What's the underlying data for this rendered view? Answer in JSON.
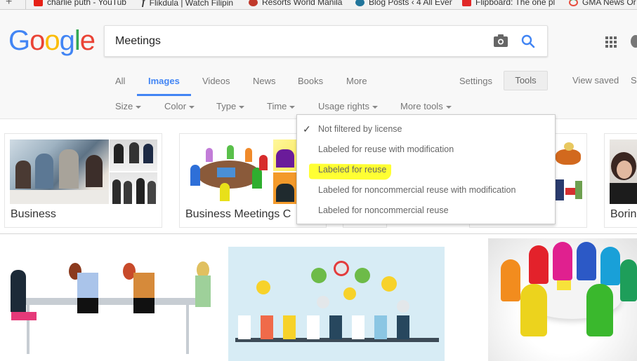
{
  "bookmarks": [
    {
      "label": "charlie puth - YouTub",
      "icon": "youtube-icon",
      "color": "#e62117"
    },
    {
      "label": "Flikdula | Watch Filipin",
      "icon": "flikdula-icon",
      "color": "#111111"
    },
    {
      "label": "Resorts World Manila",
      "icon": "resorts-world-icon",
      "color": "#c0392b"
    },
    {
      "label": "Blog Posts ‹ 4 All Ever",
      "icon": "wordpress-icon",
      "color": "#21759b"
    },
    {
      "label": "Flipboard: The one pl",
      "icon": "flipboard-icon",
      "color": "#e12828"
    },
    {
      "label": "GMA News Or",
      "icon": "gma-icon",
      "color": "#e74c3c"
    }
  ],
  "logo": {
    "letters": [
      {
        "c": "G",
        "color": "#4285f4"
      },
      {
        "c": "o",
        "color": "#ea4335"
      },
      {
        "c": "o",
        "color": "#fbbc05"
      },
      {
        "c": "g",
        "color": "#4285f4"
      },
      {
        "c": "l",
        "color": "#34a853"
      },
      {
        "c": "e",
        "color": "#ea4335"
      }
    ]
  },
  "search": {
    "value": "Meetings"
  },
  "tabs": [
    {
      "label": "All",
      "active": false
    },
    {
      "label": "Images",
      "active": true
    },
    {
      "label": "Videos",
      "active": false
    },
    {
      "label": "News",
      "active": false
    },
    {
      "label": "Books",
      "active": false
    },
    {
      "label": "More",
      "active": false
    }
  ],
  "right_nav": {
    "settings": "Settings",
    "tools": "Tools",
    "view_saved": "View saved",
    "cut_off": "S"
  },
  "filters": [
    "Size",
    "Color",
    "Type",
    "Time",
    "Usage rights",
    "More tools"
  ],
  "usage_rights_menu": {
    "items": [
      {
        "label": "Not filtered by license",
        "checked": true
      },
      {
        "label": "Labeled for reuse with modification",
        "checked": false
      },
      {
        "label": "Labeled for reuse",
        "checked": false,
        "highlighted": true
      },
      {
        "label": "Labeled for noncommercial reuse with modification",
        "checked": false
      },
      {
        "label": "Labeled for noncommercial reuse",
        "checked": false
      }
    ]
  },
  "related_cards": [
    {
      "label": "Business"
    },
    {
      "label": "Business Meetings C"
    },
    {
      "label": ""
    },
    {
      "label": "Borin"
    }
  ],
  "colors": {
    "accent": "#4285f4",
    "highlight": "#ffff33"
  }
}
